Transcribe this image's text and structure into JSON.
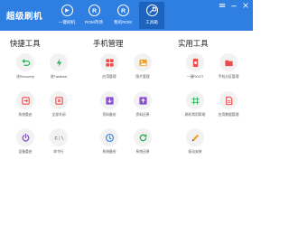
{
  "app": {
    "title": "超级刷机"
  },
  "nav": [
    {
      "label": "一键刷机"
    },
    {
      "label": "ROM市场"
    },
    {
      "label": "我的ROM"
    },
    {
      "label": "工具箱"
    }
  ],
  "sections": {
    "quick": {
      "title": "快捷工具",
      "tiles": [
        {
          "label": "进Recovery"
        },
        {
          "label": "进Fastboot"
        },
        {
          "label": "系统重启"
        },
        {
          "label": "全部关闭"
        },
        {
          "label": "设备重启"
        },
        {
          "label": "命令行"
        }
      ]
    },
    "phone": {
      "title": "手机管理",
      "tiles": [
        {
          "label": "应用管理"
        },
        {
          "label": "图片管理"
        },
        {
          "label": "资料备份"
        },
        {
          "label": "资料还原"
        },
        {
          "label": "系统备份"
        },
        {
          "label": "系统还原"
        }
      ]
    },
    "utility": {
      "title": "实用工具",
      "tiles": [
        {
          "label": "一键ROOT"
        },
        {
          "label": "手机分区管理"
        },
        {
          "label": "刷机常用帮助"
        },
        {
          "label": "应用数据管理"
        },
        {
          "label": "驱动安装"
        }
      ]
    }
  },
  "colors": {
    "header": "#2f7fe3",
    "green": "#29b35a",
    "red": "#ef4b4b",
    "orange": "#f0a229",
    "purple": "#8a4fd1",
    "blue": "#3a86e8",
    "dark": "#444444"
  }
}
